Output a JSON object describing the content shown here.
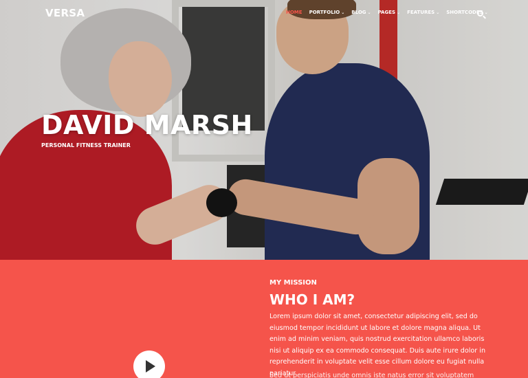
{
  "brand": {
    "logo": "VERSA"
  },
  "nav": {
    "items": [
      {
        "label": "HOME",
        "active": true,
        "dropdown": false
      },
      {
        "label": "PORTFOLIO",
        "active": false,
        "dropdown": true
      },
      {
        "label": "BLOG",
        "active": false,
        "dropdown": true
      },
      {
        "label": "PAGES",
        "active": false,
        "dropdown": true
      },
      {
        "label": "FEATURES",
        "active": false,
        "dropdown": true
      },
      {
        "label": "SHORTCODES",
        "active": false,
        "dropdown": true
      }
    ],
    "search_icon": "search-icon"
  },
  "hero": {
    "title": "DAVID MARSH",
    "subtitle": "PERSONAL FITNESS TRAINER"
  },
  "mission": {
    "label": "MY MISSION",
    "heading": "WHO I AM?",
    "paragraph": "Lorem ipsum dolor sit amet, consectetur adipiscing elit, sed do eiusmod tempor incididunt ut labore et dolore magna aliqua. Ut enim ad minim veniam, quis nostrud exercitation ullamco laboris nisi ut aliquip ex ea commodo consequat. Duis aute irure dolor in reprehenderit in voluptate velit esse cillum dolore eu fugiat nulla pariatur.",
    "paragraph2": "Sed ut perspiciatis unde omnis iste natus error sit voluptatem",
    "play_icon": "play-icon"
  },
  "colors": {
    "accent": "#f5544b",
    "nav_active": "#f7554a"
  }
}
